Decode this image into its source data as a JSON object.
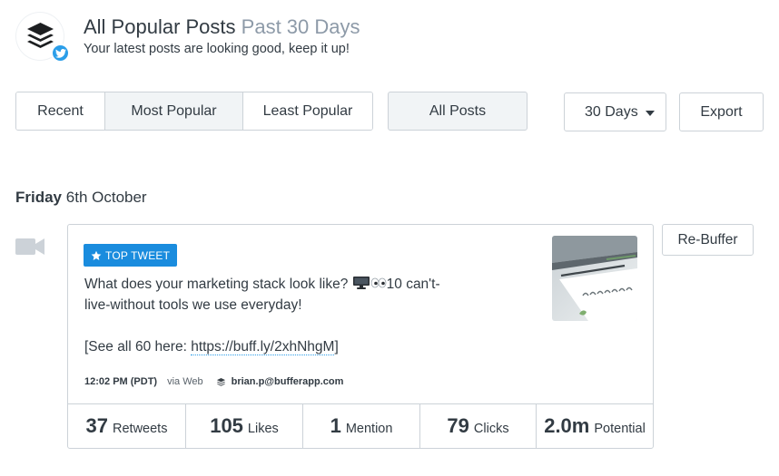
{
  "header": {
    "title": "All Popular Posts",
    "period": "Past 30 Days",
    "subtitle": "Your latest posts are looking good, keep it up!"
  },
  "filters": {
    "sort_tabs": [
      {
        "label": "Recent",
        "active": false
      },
      {
        "label": "Most Popular",
        "active": true
      },
      {
        "label": "Least Popular",
        "active": false
      }
    ],
    "post_type": "All Posts",
    "range": "30 Days",
    "export_label": "Export"
  },
  "day": {
    "weekday": "Friday",
    "date": "6th October"
  },
  "post": {
    "badge": "TOP TWEET",
    "text_line1": "What does your marketing stack look like? ",
    "text_line1_tail": "10 can't-",
    "text_line2": "live-without tools we use everyday!",
    "text_line4_prefix": "[See all 60 here: ",
    "link": "https://buff.ly/2xhNhgM",
    "text_line4_suffix": "]",
    "time": "12:02 PM (PDT)",
    "via": "via Web",
    "account": "brian.p@bufferapp.com",
    "rebuffer_label": "Re-Buffer",
    "stats": [
      {
        "value": "37",
        "label": "Retweets"
      },
      {
        "value": "105",
        "label": "Likes"
      },
      {
        "value": "1",
        "label": "Mention"
      },
      {
        "value": "79",
        "label": "Clicks"
      },
      {
        "value": "2.0m",
        "label": "Potential"
      }
    ]
  },
  "icons": {
    "logo": "buffer-stack-icon",
    "network": "twitter-icon",
    "post_type": "video-camera-icon",
    "badge": "star-icon"
  },
  "colors": {
    "accent": "#1a8cde",
    "twitter": "#2b9ee9",
    "text": "#323b43",
    "muted": "#8d9aa8",
    "border": "#ccd2d8"
  }
}
